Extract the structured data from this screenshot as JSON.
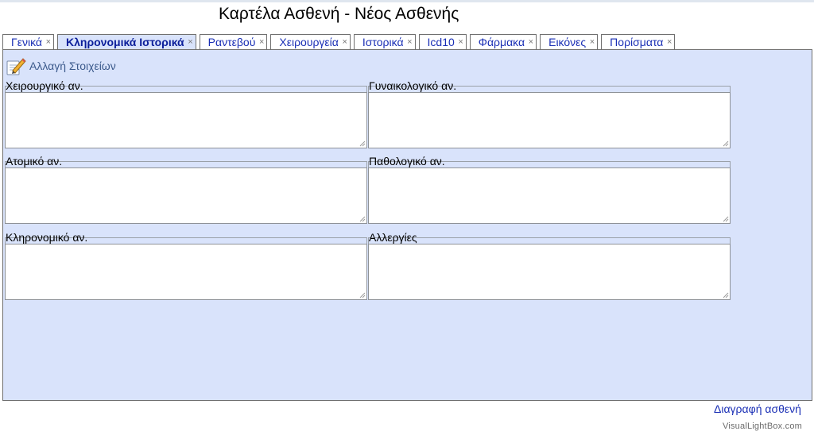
{
  "page": {
    "title": "Καρτέλα Ασθενή - Νέος Ασθενής"
  },
  "tabs": [
    {
      "label": "Γενικά",
      "active": false,
      "close": "×"
    },
    {
      "label": "Κληρονομικά Ιστορικά",
      "active": true,
      "close": "×"
    },
    {
      "label": "Ραντεβού",
      "active": false,
      "close": "×"
    },
    {
      "label": "Χειρουργεία",
      "active": false,
      "close": "×"
    },
    {
      "label": "Ιστορικά",
      "active": false,
      "close": "×"
    },
    {
      "label": "Icd10",
      "active": false,
      "close": "×"
    },
    {
      "label": "Φάρμακα",
      "active": false,
      "close": "×"
    },
    {
      "label": "Εικόνες",
      "active": false,
      "close": "×"
    },
    {
      "label": "Πορίσματα",
      "active": false,
      "close": "×"
    }
  ],
  "panel": {
    "edit_label": "Αλλαγή Στοιχείων",
    "fields": {
      "surgical": {
        "label": "Χειρουργικό αν.",
        "value": ""
      },
      "gynecological": {
        "label": "Γυναικολογικό αν.",
        "value": ""
      },
      "personal": {
        "label": "Ατομικό αν.",
        "value": ""
      },
      "pathological": {
        "label": "Παθολογικό αν.",
        "value": ""
      },
      "hereditary": {
        "label": "Κληρονομικό αν.",
        "value": ""
      },
      "allergies": {
        "label": "Αλλεργίες",
        "value": ""
      }
    }
  },
  "footer": {
    "delete_label": "Διαγραφή ασθενή",
    "watermark": "VisualLightBox.com"
  },
  "colors": {
    "panel_bg": "#d9e3fb",
    "link": "#1a2fb5",
    "active_tab_text": "#0b1e9a"
  }
}
